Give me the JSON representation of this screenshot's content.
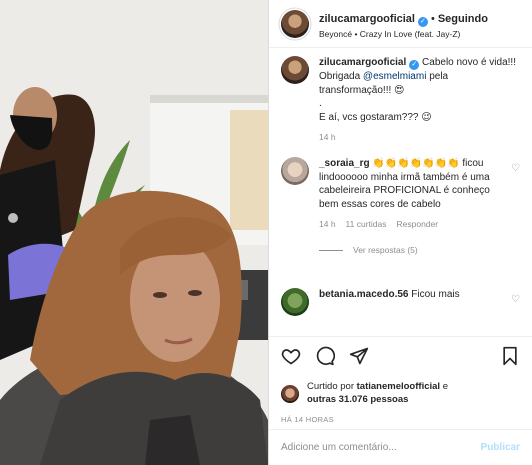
{
  "post": {
    "author": "zilucamargooficial",
    "follow_sep": "•",
    "following_label": "Seguindo",
    "song": "Beyoncé • Crazy In Love (feat. Jay-Z)",
    "more_icon": "more-options-icon"
  },
  "caption": {
    "author": "zilucamargooficial",
    "text_before": "Cabelo novo é vida!!! Obrigada ",
    "mention": "@esmelmiami",
    "text_after": " pela transformação!!! 😍",
    "dot": ".",
    "text2": "E aí, vcs gostaram??? 😉",
    "time": "14 h"
  },
  "comments": [
    {
      "author": "_soraia_rg",
      "emojis": "👏👏👏👏👏👏👏",
      "text": "ficou lindoooooo minha irmã também é uma cabeleireira PROFICIONAL é conheço bem essas cores de cabelo",
      "time": "14 h",
      "likes": "11 curtidas",
      "reply": "Responder",
      "view_replies": "Ver respostas (5)"
    },
    {
      "author": "betania.macedo.56",
      "text": "Ficou mais"
    }
  ],
  "actions": {
    "like_icon": "heart-icon",
    "comment_icon": "comment-icon",
    "share_icon": "share-icon",
    "save_icon": "bookmark-icon"
  },
  "likes": {
    "prefix": "Curtido por ",
    "user": "tatianemeloofficial",
    "middle": " e",
    "others": "outras 31.076 pessoas"
  },
  "timestamp": "HÁ 14 HORAS",
  "add_comment": {
    "placeholder": "Adicione um comentário...",
    "publish_label": "Publicar"
  },
  "colors": {
    "verified": "#3897f0",
    "publish_disabled": "#b2dffc",
    "muted": "#8e8e8e",
    "mention": "#00376b"
  }
}
